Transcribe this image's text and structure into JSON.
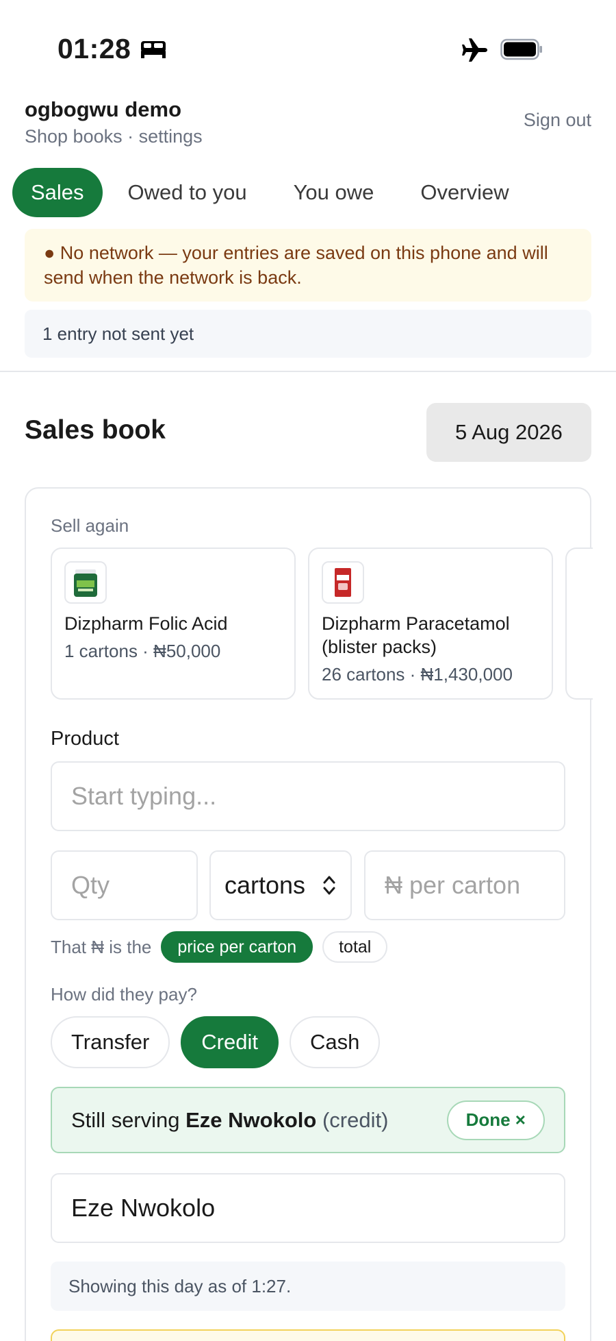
{
  "status": {
    "time": "01:28"
  },
  "header": {
    "title": "ogbogwu demo",
    "subtitle": "Shop books · settings",
    "sign_out": "Sign out"
  },
  "tabs": [
    {
      "label": "Sales",
      "active": true
    },
    {
      "label": "Owed to you",
      "active": false
    },
    {
      "label": "You owe",
      "active": false
    },
    {
      "label": "Overview",
      "active": false
    }
  ],
  "network_banner": {
    "text": "● No network — your entries are saved on this phone and will send when the network is back."
  },
  "pending": {
    "text": "1 entry not sent yet"
  },
  "sales_book": {
    "title": "Sales book",
    "date": "5 Aug 2026"
  },
  "sell_again": {
    "label": "Sell again",
    "items": [
      {
        "name": "Dizpharm Folic Acid",
        "meta": "1 cartons · ₦50,000"
      },
      {
        "name": "Dizpharm Paracetamol (blister packs)",
        "meta": "26 cartons · ₦1,430,000"
      }
    ]
  },
  "form": {
    "product_label": "Product",
    "product_placeholder": "Start typing...",
    "qty_placeholder": "Qty",
    "unit": "cartons",
    "price_placeholder": "₦ per carton",
    "price_mode_prefix": "That ₦ is the",
    "price_mode_options": [
      "price per carton",
      "total"
    ],
    "pay_label": "How did they pay?",
    "pay_options": [
      "Transfer",
      "Credit",
      "Cash"
    ]
  },
  "serving": {
    "prefix": "Still serving",
    "customer": "Eze Nwokolo",
    "suffix": "(credit)",
    "done": "Done ×"
  },
  "customer_field": {
    "value": "Eze Nwokolo"
  },
  "as_of": {
    "text": "Showing this day as of 1:27."
  },
  "colors": {
    "accent": "#167a3c",
    "banner_bg": "#fefae8",
    "banner_text": "#7a3a12",
    "serving_bg": "#ebf7ef"
  }
}
